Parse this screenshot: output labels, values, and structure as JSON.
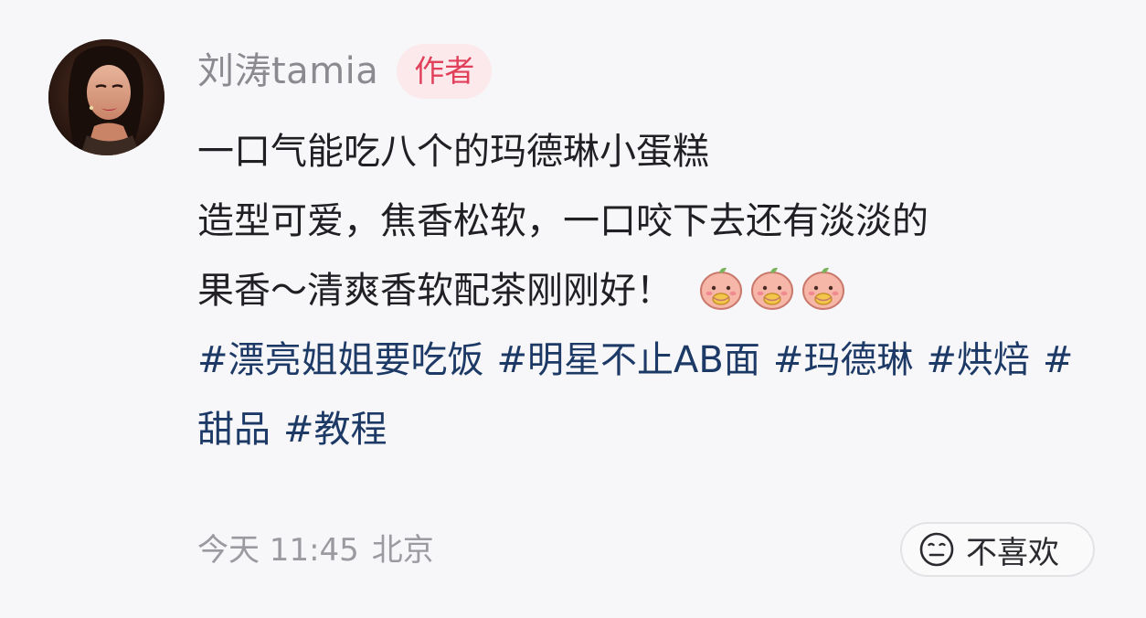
{
  "author": {
    "name": "刘涛tamia",
    "badge": "作者"
  },
  "post": {
    "title_line": "一口气能吃八个的玛德琳小蛋糕",
    "body_line1": "造型可爱，焦香松软，一口咬下去还有淡淡的",
    "body_line2": "果香～清爽香软配茶刚刚好！",
    "emoji_icons": [
      "peach-emoji",
      "peach-emoji",
      "peach-emoji"
    ],
    "hashtags": [
      "#漂亮姐姐要吃饭",
      "#明星不止AB面",
      "#玛德琳",
      "#烘焙",
      "#甜品",
      "#教程"
    ]
  },
  "meta": {
    "time": "今天 11:45",
    "location": "北京"
  },
  "actions": {
    "dislike_label": "不喜欢",
    "dislike_icon": "neutral-face-icon"
  },
  "colors": {
    "hashtag": "#1d3a67",
    "badge_text": "#e0405a",
    "badge_bg": "#fbe9ec"
  }
}
